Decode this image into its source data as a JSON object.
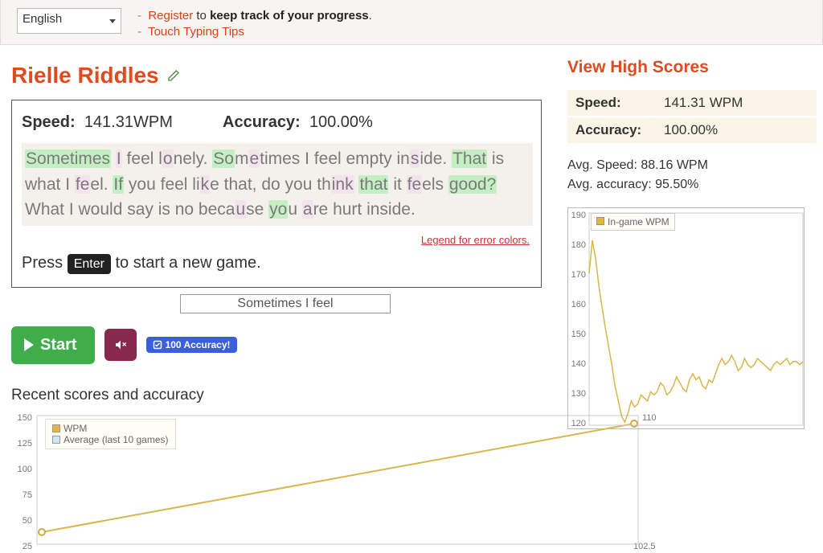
{
  "top": {
    "language": "English",
    "register_link": "Register",
    "register_tail": " to ",
    "register_bold": "keep track of your progress",
    "tips_link": "Touch Typing Tips"
  },
  "title": "Rielle Riddles",
  "game": {
    "speed_label": "Speed:",
    "speed_value": "141.31WPM",
    "accuracy_label": "Accuracy:",
    "accuracy_value": "100.00%",
    "text_plain": "Sometimes I feel lonely. Sometimes I feel empty inside. That is what I feel. If you feel like that, do you think that it feels good? What I would say is no because you are hurt inside.",
    "legend_link": "Legend for error colors.",
    "press_pre": "Press ",
    "press_key": "Enter",
    "press_post": " to start a new game.",
    "input_display": "Sometimes I feel"
  },
  "buttons": {
    "start": "Start",
    "badge_100": "100 Accuracy!"
  },
  "recent_header": "Recent scores and accuracy",
  "right": {
    "view_hs": "View High Scores",
    "speed_label": "Speed:",
    "speed_value": "141.31 WPM",
    "acc_label": "Accuracy:",
    "acc_value": "100.00%",
    "avg_speed": "Avg. Speed: 88.16 WPM",
    "avg_accuracy": "Avg. accuracy: 95.50%",
    "ingame_legend": "In-game WPM",
    "recent_legend_wpm": "WPM",
    "recent_legend_avg": "Average (last 10 games)"
  },
  "chart_data": [
    {
      "type": "line",
      "title": "In-game WPM",
      "ylabel": "WPM",
      "ylim": [
        120,
        190
      ],
      "x": [
        0,
        1,
        2,
        3,
        4,
        5,
        6,
        7,
        8,
        9,
        10,
        11,
        12,
        13,
        14,
        15,
        16,
        17,
        18,
        19,
        20,
        21,
        22,
        23,
        24,
        25,
        26,
        27,
        28,
        29,
        30,
        31,
        32,
        33,
        34,
        35,
        36,
        37,
        38,
        39,
        40,
        41,
        42,
        43,
        44,
        45,
        46,
        47,
        48,
        49,
        50,
        51,
        52,
        53,
        54,
        55,
        56,
        57,
        58,
        59,
        60,
        61,
        62,
        63,
        64,
        65,
        66
      ],
      "series": [
        {
          "name": "In-game WPM",
          "values": [
            170,
            181,
            175,
            166,
            159,
            152,
            146,
            140,
            133,
            128,
            123,
            121,
            124,
            128,
            126,
            127,
            130,
            129,
            128,
            131,
            130,
            131,
            134,
            133,
            130,
            131,
            133,
            136,
            134,
            132,
            131,
            135,
            137,
            135,
            136,
            133,
            132,
            135,
            134,
            137,
            140,
            142,
            140,
            141,
            143,
            141,
            138,
            139,
            142,
            140,
            139,
            140,
            142,
            141,
            140,
            139,
            138,
            140,
            141,
            140,
            141,
            142,
            140,
            141,
            141,
            140,
            141
          ]
        }
      ]
    },
    {
      "type": "line",
      "title": "Recent scores and accuracy",
      "ylabel_left": "WPM",
      "ylim_left": [
        25,
        150
      ],
      "ylim_right": [
        102.5,
        110
      ],
      "x": [
        1,
        2
      ],
      "series": [
        {
          "name": "WPM",
          "values": [
            36,
            142
          ]
        },
        {
          "name": "Average (last 10 games)",
          "values": [
            null,
            null
          ]
        }
      ]
    }
  ]
}
